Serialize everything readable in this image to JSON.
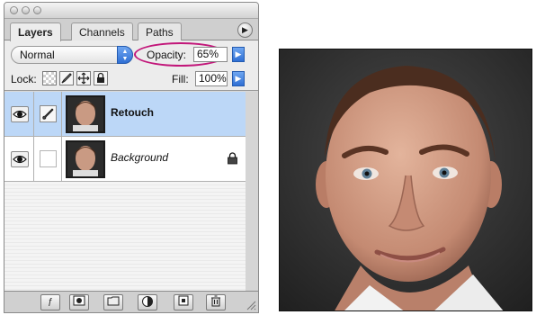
{
  "palette": {
    "tabs": [
      {
        "label": "Layers"
      },
      {
        "label": "Channels"
      },
      {
        "label": "Paths"
      }
    ],
    "blend_mode": "Normal",
    "opacity_label": "Opacity:",
    "opacity_value": "65%",
    "lock_label": "Lock:",
    "fill_label": "Fill:",
    "fill_value": "100%",
    "layers": [
      {
        "name": "Retouch",
        "selected": true
      },
      {
        "name": "Background",
        "selected": false
      }
    ]
  },
  "colors": {
    "selection": "#bcd7f7",
    "highlight_oval": "#c2177a",
    "arrow_blue": "#2f6fd4"
  }
}
